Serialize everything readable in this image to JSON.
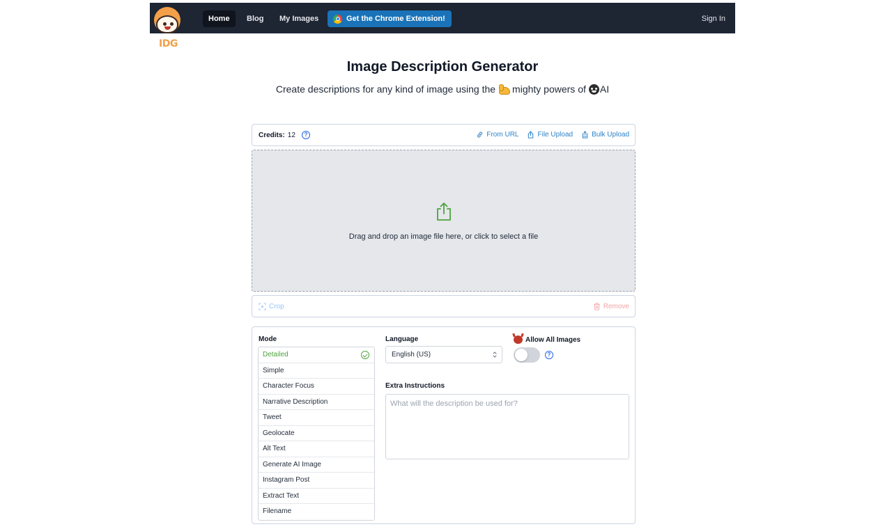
{
  "logo": {
    "text": "IDG"
  },
  "nav": {
    "home": "Home",
    "blog": "Blog",
    "my_images": "My Images",
    "chrome_extension": "Get the Chrome Extension!",
    "sign_in": "Sign In"
  },
  "header": {
    "title": "Image Description Generator",
    "subtitle_part1": "Create descriptions for any kind of image using the",
    "subtitle_part2": "mighty powers of",
    "subtitle_part3": "AI"
  },
  "credits_bar": {
    "credits_label": "Credits:",
    "credits_value": "12",
    "from_url": "From URL",
    "file_upload": "File Upload",
    "bulk_upload": "Bulk Upload"
  },
  "dropzone": {
    "text": "Drag and drop an image file here, or click to select a file"
  },
  "crop_bar": {
    "crop": "Crop",
    "remove": "Remove"
  },
  "options": {
    "mode_label": "Mode",
    "modes": [
      "Detailed",
      "Simple",
      "Character Focus",
      "Narrative Description",
      "Tweet",
      "Geolocate",
      "Alt Text",
      "Generate AI Image",
      "Instagram Post",
      "Extract Text",
      "Filename"
    ],
    "selected_mode": "Detailed",
    "language_label": "Language",
    "language_value": "English (US)",
    "allow_all_label": "Allow All Images",
    "allow_all_enabled": false,
    "extra_label": "Extra Instructions",
    "extra_placeholder": "What will the description be used for?"
  },
  "colors": {
    "navbar": "#1e2533",
    "chrome_button": "#1a73b8",
    "link_blue": "#2d82c7",
    "selected_green": "#4ea33d",
    "remove_red": "#f5a3a3"
  }
}
